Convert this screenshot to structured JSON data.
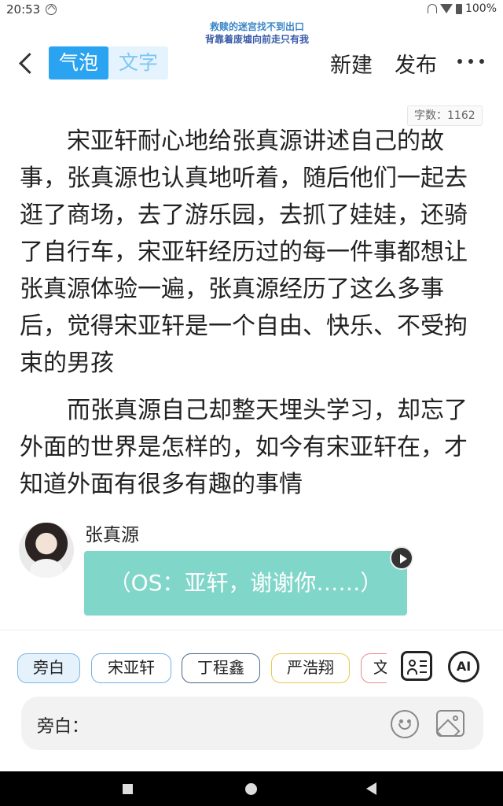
{
  "status_bar": {
    "time": "20:53",
    "battery": "100%"
  },
  "marquee": {
    "line1": "救赎的迷宫找不到出口",
    "line2": "背靠着废墟向前走只有我"
  },
  "header": {
    "tab_bubble": "气泡",
    "tab_text": "文字",
    "active_tab": "气泡",
    "new_label": "新建",
    "publish_label": "发布"
  },
  "content": {
    "word_count": "字数：1162",
    "paragraph1": "宋亚轩耐心地给张真源讲述自己的故事，张真源也认真地听着，随后他们一起去逛了商场，去了游乐园，去抓了娃娃，还骑了自行车，宋亚轩经历过的每一件事都想让张真源体验一遍，张真源经历了这么多事后，觉得宋亚轩是一个自由、快乐、不受拘束的男孩",
    "paragraph2": "而张真源自己却整天埋头学习，却忘了外面的世界是怎样的，如今有宋亚轩在，才知道外面有很多有趣的事情"
  },
  "chat": {
    "speaker": "张真源",
    "message": "（OS：亚轩，谢谢你……）"
  },
  "role_chips": [
    {
      "label": "旁白",
      "color": "#7bb7ea"
    },
    {
      "label": "宋亚轩",
      "color": "#6fb0e8"
    },
    {
      "label": "丁程鑫",
      "color": "#4a6a8a"
    },
    {
      "label": "严浩翔",
      "color": "#e9c94a"
    },
    {
      "label": "文",
      "color": "#e88a8a"
    }
  ],
  "toolbar": {
    "ai_label": "AI"
  },
  "input": {
    "label": "旁白："
  },
  "colors": {
    "accent": "#2aa3f0",
    "bubble": "#80d6c9"
  }
}
